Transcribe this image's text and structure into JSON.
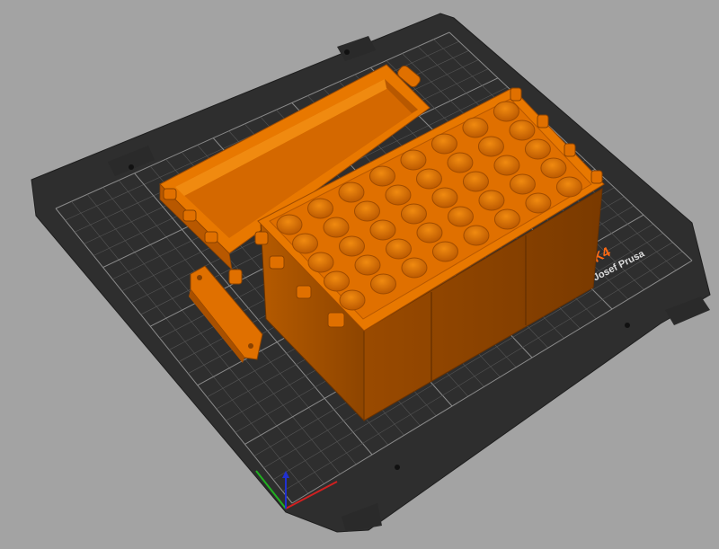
{
  "viewport": {
    "background": "#a3a3a3"
  },
  "print_bed": {
    "brand_model": "MK4",
    "brand_tagline": "by Josef Prusa",
    "colors": {
      "bed": "#2e2e2e",
      "grid_line": "#5a5a5a",
      "accent": "#ff6a13",
      "text": "#dddddd"
    }
  },
  "models": {
    "color": "#e07000",
    "items": [
      {
        "name": "lid"
      },
      {
        "name": "cartridge-box"
      },
      {
        "name": "hinge-clip"
      }
    ],
    "box_grid": {
      "rows": 5,
      "cols": 8
    }
  },
  "axes": {
    "x_color": "#d02020",
    "y_color": "#20b020",
    "z_color": "#2030d0"
  }
}
